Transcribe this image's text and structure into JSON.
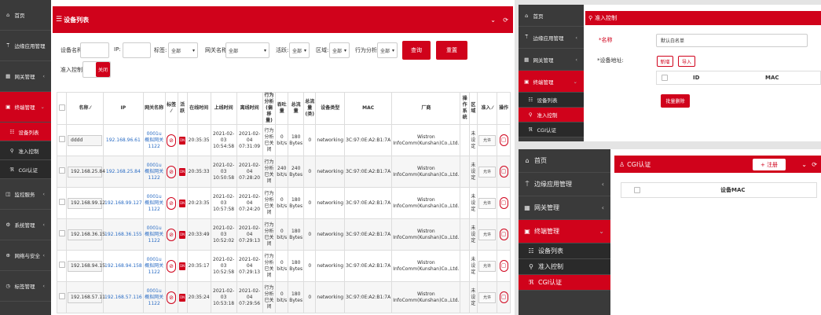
{
  "main": {
    "sidebar": [
      {
        "icon": "⌂",
        "label": "首页"
      },
      {
        "icon": "⍑",
        "label": "边缘应用管理",
        "arrow": "‹"
      },
      {
        "icon": "▦",
        "label": "网关管理",
        "arrow": "‹"
      },
      {
        "icon": "▣",
        "label": "终端管理",
        "arrow": "⌄",
        "active": true
      },
      {
        "icon": "☷",
        "label": "设备列表",
        "sub": true,
        "active": true
      },
      {
        "icon": "⚲",
        "label": "准入控制",
        "sub": true
      },
      {
        "icon": "ℜ",
        "label": "CGI认证",
        "sub": true
      },
      {
        "icon": "◫",
        "label": "监控服务",
        "arrow": "‹"
      },
      {
        "icon": "⚙",
        "label": "系统管理",
        "arrow": "‹"
      },
      {
        "icon": "⊕",
        "label": "网络与安全",
        "arrow": "‹"
      },
      {
        "icon": "◷",
        "label": "标签管理",
        "arrow": "‹"
      }
    ],
    "header": {
      "icon": "☰",
      "title": "设备列表",
      "icon_collapse": "⌄",
      "icon_refresh": "⟳"
    },
    "filters": {
      "name_label": "设备名称:",
      "ip_label": "IP:",
      "tag_label": "标签:",
      "tag_value": "全部",
      "gw_label": "网关名称:",
      "gw_value": "全部",
      "active_label": "活跃:",
      "active_value": "全部",
      "area_label": "区域:",
      "area_value": "全部",
      "behav_label": "行为分析:",
      "behav_value": "全部",
      "query_btn": "查询",
      "reset_btn": "重置",
      "access_label": "准入控制:",
      "access_toggle": "关闭"
    },
    "table": {
      "headers": [
        "名称 ⁄",
        "IP",
        "网关名称",
        "标签 ⁄",
        "活跃",
        "在线时间",
        "上线时间",
        "离线时间",
        "行为分析(偏移量)",
        "吞吐量",
        "总流量",
        "总流量(类)",
        "设备类型",
        "MAC",
        "厂商",
        "操作系统",
        "区域",
        "准入 ⁄",
        "操作"
      ],
      "rows": [
        {
          "name": "dddd",
          "ip": "192.168.96.61",
          "gw": "0001u概拟网关1122",
          "live": "20:35:35",
          "up": "2021-02-03 10:54:58",
          "down": "2021-02-04 07:31:09",
          "behav": "行为分析已关闭",
          "thr": "0 bit/s",
          "total": "180 Bytes",
          "count": "0",
          "dtype": "networking",
          "mac": "3C:97:0E:A2:B1:7A",
          "vendor": "Wistron InfoComm(Kunshan)Co.,Ltd.",
          "os": "",
          "area": "未设定",
          "access": "允许"
        },
        {
          "name": "192.168.25.84",
          "ip": "192.168.25.84",
          "gw": "0001u概拟网关1122",
          "live": "20:35:33",
          "up": "2021-02-03 10:50:58",
          "down": "2021-02-04 07:28:20",
          "behav": "行为分析已关闭",
          "thr": "240 bit/s",
          "total": "240 Bytes",
          "count": "0",
          "dtype": "networking",
          "mac": "3C:97:0E:A2:B1:7A",
          "vendor": "Wistron InfoComm(Kunshan)Co.,Ltd.",
          "os": "",
          "area": "未设定",
          "access": "允许"
        },
        {
          "name": "192.168.99.12",
          "ip": "192.168.99.127",
          "gw": "0001u概拟网关1122",
          "live": "20:23:35",
          "up": "2021-02-03 10:57:58",
          "down": "2021-02-04 07:24:20",
          "behav": "行为分析已关闭",
          "thr": "0 bit/s",
          "total": "180 Bytes",
          "count": "0",
          "dtype": "networking",
          "mac": "3C:97:0E:A2:B1:7A",
          "vendor": "Wistron InfoComm(Kunshan)Co.,Ltd.",
          "os": "",
          "area": "未设定",
          "access": "允许"
        },
        {
          "name": "192.168.36.15",
          "ip": "192.168.36.155",
          "gw": "0001u概拟网关1122",
          "live": "20:33:49",
          "up": "2021-02-03 10:52:02",
          "down": "2021-02-04 07:29:13",
          "behav": "行为分析已关闭",
          "thr": "0 bit/s",
          "total": "180 Bytes",
          "count": "0",
          "dtype": "networking",
          "mac": "3C:97:0E:A2:B1:7A",
          "vendor": "Wistron InfoComm(Kunshan)Co.,Ltd.",
          "os": "",
          "area": "未设定",
          "access": "允许"
        },
        {
          "name": "192.168.94.15",
          "ip": "192.168.94.158",
          "gw": "0001u概拟网关1122",
          "live": "20:35:17",
          "up": "2021-02-03 10:52:58",
          "down": "2021-02-04 07:29:13",
          "behav": "行为分析已关闭",
          "thr": "0 bit/s",
          "total": "180 Bytes",
          "count": "0",
          "dtype": "networking",
          "mac": "3C:97:0E:A2:B1:7A",
          "vendor": "Wistron InfoComm(Kunshan)Co.,Ltd.",
          "os": "",
          "area": "未设定",
          "access": "允许"
        },
        {
          "name": "192.168.57.11",
          "ip": "192.168.57.116",
          "gw": "0001u概拟网关1122",
          "live": "20:35:24",
          "up": "2021-02-03 10:53:18",
          "down": "2021-02-04 07:29:56",
          "behav": "行为分析已关闭",
          "thr": "0 bit/s",
          "total": "180 Bytes",
          "count": "0",
          "dtype": "networking",
          "mac": "3C:97:0E:A2:B1:7A",
          "vendor": "Wistron InfoComm(Kunshan)Co.,Ltd.",
          "os": "",
          "area": "未设定",
          "access": "允许"
        }
      ],
      "tag_icon": "⊘",
      "live_tag": "DN",
      "op_icon": "▢",
      "select_caret": "⌄"
    }
  },
  "access_panel": {
    "sidebar": [
      {
        "icon": "⌂",
        "label": "首页"
      },
      {
        "icon": "⍑",
        "label": "边缘应用管理",
        "arrow": "‹"
      },
      {
        "icon": "▦",
        "label": "网关管理",
        "arrow": "‹"
      },
      {
        "icon": "▣",
        "label": "终端管理",
        "arrow": "⌄",
        "active": true
      },
      {
        "icon": "☷",
        "label": "设备列表",
        "sub": true
      },
      {
        "icon": "⚲",
        "label": "准入控制",
        "sub": true,
        "active": true
      },
      {
        "icon": "ℜ",
        "label": "CGI认证",
        "sub": true
      }
    ],
    "header": {
      "icon": "⚲",
      "title": "准入控制"
    },
    "name_label": "*名称",
    "name_value": "默认白名单",
    "addr_label": "*设备地址:",
    "add_btn": "新增",
    "import_btn": "导入",
    "col_id": "ID",
    "col_mac": "MAC",
    "batch_delete": "批量删除"
  },
  "cgi_panel": {
    "sidebar": [
      {
        "icon": "⌂",
        "label": "首页"
      },
      {
        "icon": "⍑",
        "label": "边缘应用管理",
        "arrow": "‹"
      },
      {
        "icon": "▦",
        "label": "网关管理",
        "arrow": "‹"
      },
      {
        "icon": "▣",
        "label": "终端管理",
        "arrow": "⌄",
        "active": true
      },
      {
        "icon": "☷",
        "label": "设备列表",
        "sub": true
      },
      {
        "icon": "⚲",
        "label": "准入控制",
        "sub": true
      },
      {
        "icon": "ℜ",
        "label": "CGI认证",
        "sub": true,
        "active": true
      }
    ],
    "header": {
      "icon": "♙",
      "title": "CGI认证",
      "register_btn": "+ 注册",
      "icon_collapse": "⌄",
      "icon_refresh": "⟳"
    },
    "col_mac": "设备MAC"
  },
  "colors": {
    "accent": "#d0021b",
    "sidebar": "#3a3a3a",
    "link": "#2a6cc4"
  }
}
